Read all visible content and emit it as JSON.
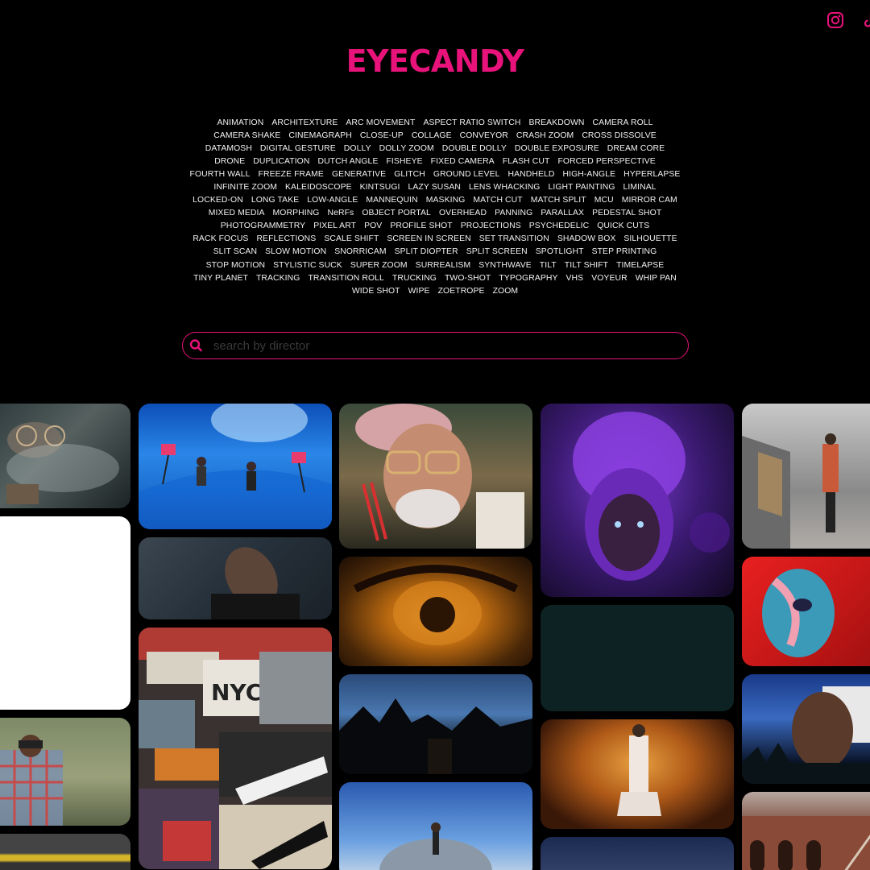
{
  "header": {
    "logo": "EYECANDY",
    "social": [
      {
        "icon": "instagram-icon"
      },
      {
        "icon": "tiktok-icon"
      }
    ]
  },
  "tags": [
    "ANIMATION",
    "ARCHITEXTURE",
    "ARC MOVEMENT",
    "ASPECT RATIO SWITCH",
    "BREAKDOWN",
    "CAMERA ROLL",
    "CAMERA SHAKE",
    "CINEMAGRAPH",
    "CLOSE-UP",
    "COLLAGE",
    "CONVEYOR",
    "CRASH ZOOM",
    "CROSS DISSOLVE",
    "DATAMOSH",
    "DIGITAL GESTURE",
    "DOLLY",
    "DOLLY ZOOM",
    "DOUBLE DOLLY",
    "DOUBLE EXPOSURE",
    "DREAM CORE",
    "DRONE",
    "DUPLICATION",
    "DUTCH ANGLE",
    "FISHEYE",
    "FIXED CAMERA",
    "FLASH CUT",
    "FORCED PERSPECTIVE",
    "FOURTH WALL",
    "FREEZE FRAME",
    "GENERATIVE",
    "GLITCH",
    "GROUND LEVEL",
    "HANDHELD",
    "HIGH-ANGLE",
    "HYPERLAPSE",
    "INFINITE ZOOM",
    "KALEIDOSCOPE",
    "KINTSUGI",
    "LAZY SUSAN",
    "LENS WHACKING",
    "LIGHT PAINTING",
    "LIMINAL",
    "LOCKED-ON",
    "LONG TAKE",
    "LOW-ANGLE",
    "MANNEQUIN",
    "MASKING",
    "MATCH CUT",
    "MATCH SPLIT",
    "MCU",
    "MIRROR CAM",
    "MIXED MEDIA",
    "MORPHING",
    "NeRFs",
    "OBJECT PORTAL",
    "OVERHEAD",
    "PANNING",
    "PARALLAX",
    "PEDESTAL SHOT",
    "PHOTOGRAMMETRY",
    "PIXEL ART",
    "POV",
    "PROFILE SHOT",
    "PROJECTIONS",
    "PSYCHEDELIC",
    "QUICK CUTS",
    "RACK FOCUS",
    "REFLECTIONS",
    "SCALE SHIFT",
    "SCREEN IN SCREEN",
    "SET TRANSITION",
    "SHADOW BOX",
    "SILHOUETTE",
    "SLIT SCAN",
    "SLOW MOTION",
    "SNORRICAM",
    "SPLIT DIOPTER",
    "SPLIT SCREEN",
    "SPOTLIGHT",
    "STEP PRINTING",
    "STOP MOTION",
    "STYLISTIC SUCK",
    "SUPER ZOOM",
    "SURREALISM",
    "SYNTHWAVE",
    "TILT",
    "TILT SHIFT",
    "TIMELAPSE",
    "TINY PLANET",
    "TRACKING",
    "TRANSITION ROLL",
    "TRUCKING",
    "TWO-SHOT",
    "TYPOGRAPHY",
    "VHS",
    "VOYEUR",
    "WHIP PAN",
    "WIDE SHOT",
    "WIPE",
    "ZOETROPE",
    "ZOOM"
  ],
  "search": {
    "placeholder": "search by director",
    "value": "",
    "icon": "search-icon"
  },
  "colors": {
    "accent": "#e8137a",
    "background": "#000000"
  },
  "grid": {
    "columns": [
      [
        "smoke-glasses-portrait",
        "blank-white-frame",
        "binoculars-checkered-shirt",
        "yellow-striped-frame"
      ],
      [
        "pool-underwater-dancers",
        "head-back-blur",
        "nyc-collage-sneakers"
      ],
      [
        "chopsticks-smoke-portrait",
        "amber-eye-closeup",
        "dark-tree-silhouette",
        "tiny-planet-figure"
      ],
      [
        "purple-hair-portrait",
        "dark-teal-frame",
        "orange-corridor-figure",
        "dusk-sky-frame"
      ],
      [
        "ruined-hall-performer",
        "red-paint-face",
        "floating-face-collage",
        "brick-building-stairs"
      ]
    ]
  }
}
